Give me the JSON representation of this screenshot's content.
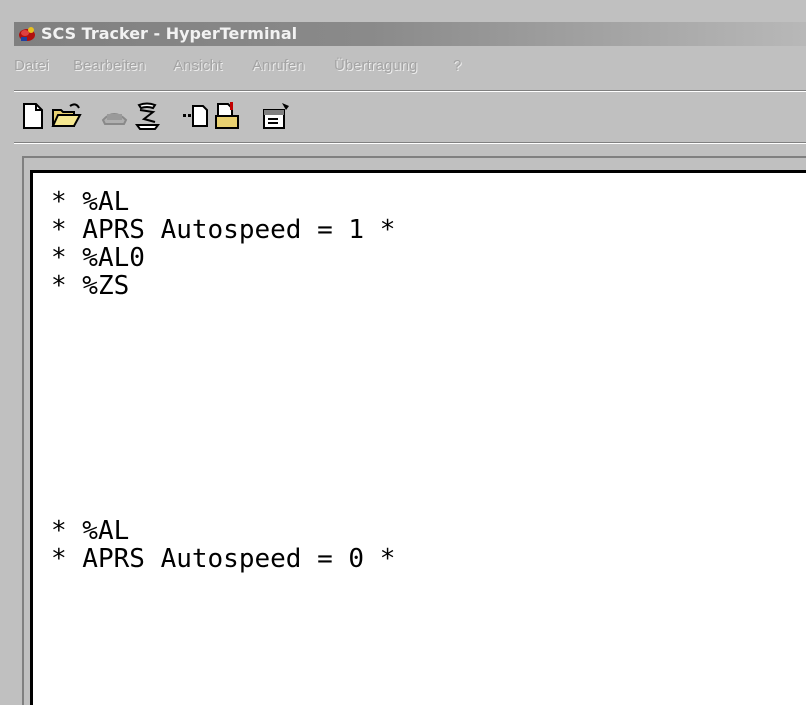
{
  "window": {
    "title": "SCS Tracker - HyperTerminal",
    "app_icon": "hyperterminal-phone-icon"
  },
  "menu": {
    "items": [
      {
        "label": "Datei"
      },
      {
        "label": "Bearbeiten"
      },
      {
        "label": "Ansicht"
      },
      {
        "label": "Anrufen"
      },
      {
        "label": "Übertragung"
      },
      {
        "label": "?"
      }
    ]
  },
  "toolbar": {
    "buttons": [
      {
        "icon": "new-document-icon"
      },
      {
        "icon": "open-folder-icon"
      },
      {
        "icon": "phone-connect-icon"
      },
      {
        "icon": "phone-disconnect-icon"
      },
      {
        "icon": "send-file-icon"
      },
      {
        "icon": "receive-file-icon"
      },
      {
        "icon": "properties-icon"
      }
    ]
  },
  "terminal": {
    "lines": [
      "* %AL",
      "* APRS Autospeed = 1 *",
      "* %AL0",
      "* %ZS",
      "* %AL",
      "* APRS Autospeed = 0 *"
    ]
  },
  "colors": {
    "window_bg": "#c0c0c0",
    "titlebar_inactive": "#808080",
    "title_text": "#f2f2f2",
    "menu_text_disabled": "#a4a4a4",
    "terminal_bg": "#ffffff",
    "terminal_text": "#000000"
  }
}
